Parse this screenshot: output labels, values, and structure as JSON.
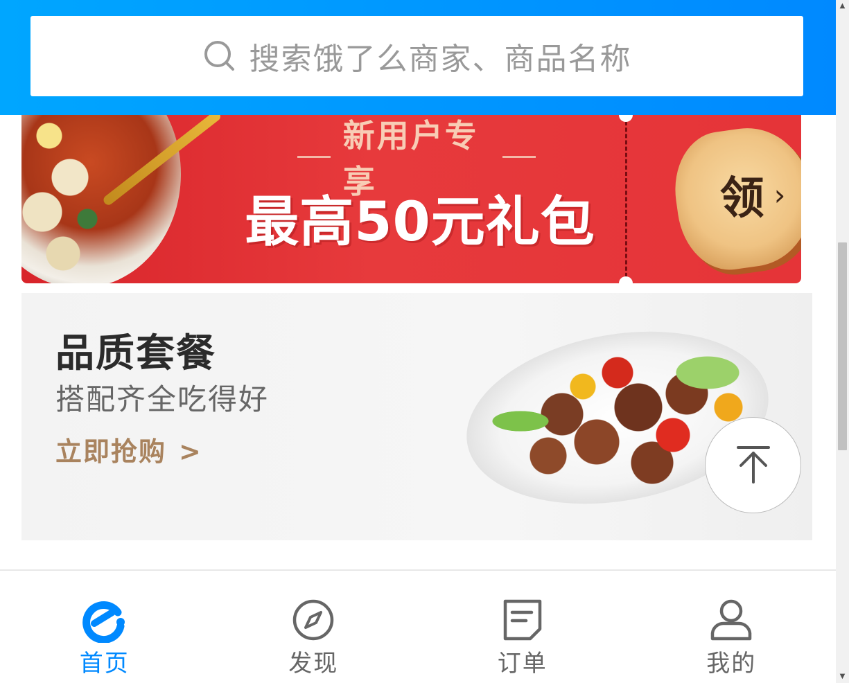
{
  "search": {
    "placeholder": "搜索饿了么商家、商品名称"
  },
  "promo_banner": {
    "subtitle": "新用户专享",
    "title": "最高50元礼包",
    "claim_label": "领",
    "claim_chevron": "›"
  },
  "meal_card": {
    "title": "品质套餐",
    "subtitle": "搭配齐全吃得好",
    "cta_label": "立即抢购",
    "cta_arrow": ">"
  },
  "back_to_top": {
    "icon": "arrow-up-to-top-icon"
  },
  "bottom_nav": {
    "items": [
      {
        "label": "首页",
        "icon": "eleme-logo-icon",
        "active": true
      },
      {
        "label": "发现",
        "icon": "compass-icon",
        "active": false
      },
      {
        "label": "订单",
        "icon": "order-list-icon",
        "active": false
      },
      {
        "label": "我的",
        "icon": "user-icon",
        "active": false
      }
    ]
  },
  "colors": {
    "header_start": "#00a6ff",
    "header_end": "#0089ff",
    "promo_red": "#e53438",
    "cta_brown": "#a9835e",
    "active_blue": "#0089ff",
    "inactive_gray": "#666666"
  }
}
